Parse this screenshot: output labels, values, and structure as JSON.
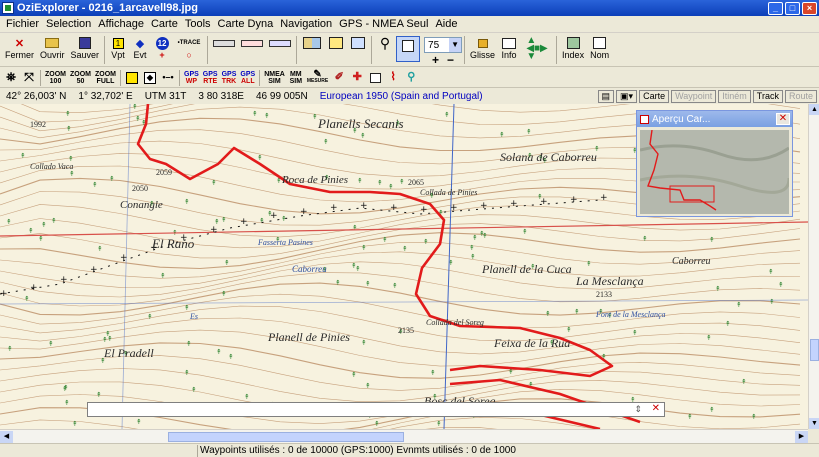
{
  "window": {
    "title": "OziExplorer - 0216_1arcavell98.jpg"
  },
  "menu": [
    "Fichier",
    "Selection",
    "Affichage",
    "Carte",
    "Tools",
    "Carte Dyna",
    "Navigation",
    "GPS - NMEA Seul",
    "Aide"
  ],
  "toolbar1": {
    "fermer": "Fermer",
    "ouvrir": "Ouvrir",
    "sauver": "Sauver",
    "vpt": "Vpt",
    "evt": "Evt",
    "badge12": "12",
    "trace": "TRACE",
    "zoom_value": "75",
    "glisse": "Glisse",
    "info": "Info",
    "index": "Index",
    "nom": "Nom",
    "symbols": {
      "sym1": "1",
      "sym2": "◆",
      "sym3": "●",
      "plus": "+",
      "circ": "○",
      "minus": "−"
    }
  },
  "toolbar2": {
    "zoom100": [
      "ZOOM",
      "100"
    ],
    "zoom50": [
      "ZOOM",
      "50"
    ],
    "zoomfull": [
      "ZOOM",
      "FULL"
    ],
    "gps1": [
      "GPS",
      "WP"
    ],
    "gps2": [
      "GPS",
      "RTE"
    ],
    "gps3": [
      "GPS",
      "TRK"
    ],
    "gps4": [
      "GPS",
      "ALL"
    ],
    "nmea": [
      "NMEA",
      "SIM"
    ],
    "mm": [
      "MM",
      "SIM"
    ],
    "ruler": "MESURE"
  },
  "status": {
    "lat": "42° 26,003' N",
    "lon": "1° 32,702' E",
    "utm": "UTM  31T",
    "east": "3 80 318E",
    "north": "46 99 005N",
    "datum": "European 1950 (Spain and Portugal)"
  },
  "status_buttons": {
    "carte": "Carte",
    "waypoint": "Waypoint",
    "itineme": "Itiném",
    "track": "Track",
    "route": "Route"
  },
  "map_labels": {
    "planells_secanis": "Planells Secanis",
    "solana_caborreu": "Solana de Caborreu",
    "roca_pinies": "Roca de Pinies",
    "collada_pinies": "Collada de Pinies",
    "conangle": "Conangle",
    "collado_vaca": "Collado Vaca",
    "el_rano": "El Rano",
    "prat_fasses": "Fasserta Pasines",
    "planell_cuca": "Planell de la Cuca",
    "la_mesclanca": "La Mesclança",
    "caborreu": "Caborreu",
    "caboreu_small": "Caborreu",
    "mesclanca_small": "Font de la Mesclança",
    "planell_pinies": "Planell de Pinies",
    "collada_soreg": "Collada del Soreg",
    "feixa_rua": "Feixa de la Rua",
    "pradell": "El Pradell",
    "bosc_soreg": "Bosc del Soreg",
    "el_vall": "Es",
    "h2133": "2133",
    "h2135": "2135",
    "h2050": "2050",
    "h2059": "2059",
    "h1992": "1992",
    "h2065": "2065"
  },
  "overview": {
    "title": "Aperçu Car..."
  },
  "statusbar": {
    "waypoints": "Waypoints utilisés : 0 de 10000 (GPS:1000)    Evnmts utilisés : 0 de 1000"
  },
  "colors": {
    "track": "#e21b1b",
    "contour": "#c7a17d",
    "grid_red": "#d8504a",
    "grid_blue": "#4066c8",
    "titlebar": "#0b3fb8"
  }
}
